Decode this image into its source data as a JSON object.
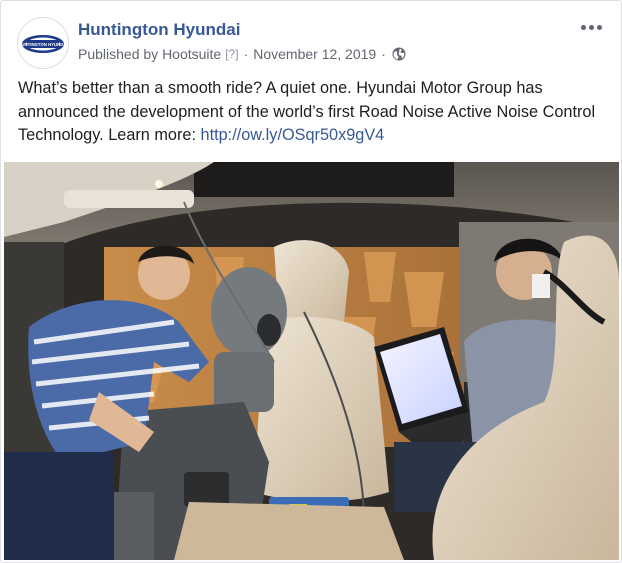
{
  "post": {
    "page_name": "Huntington Hyundai",
    "published_prefix": "Published by",
    "publisher": "Hootsuite",
    "help_marker": "[?]",
    "separator": "·",
    "date": "November 12, 2019",
    "audience_icon": "globe-icon",
    "more_icon": "more-options-icon",
    "text_main": "What’s better than a smooth ride? A quiet one. Hyundai Motor Group has announced the development of the world’s first Road Noise Active Noise Control Technology. Learn more: ",
    "link_text": "http://ow.ly/OSqr50x9gV4",
    "avatar_text": "HUNTINGTON HYUNDAI"
  },
  "colors": {
    "link": "#385898",
    "text": "#1c1e21",
    "meta": "#606770",
    "border": "#dddfe2"
  }
}
